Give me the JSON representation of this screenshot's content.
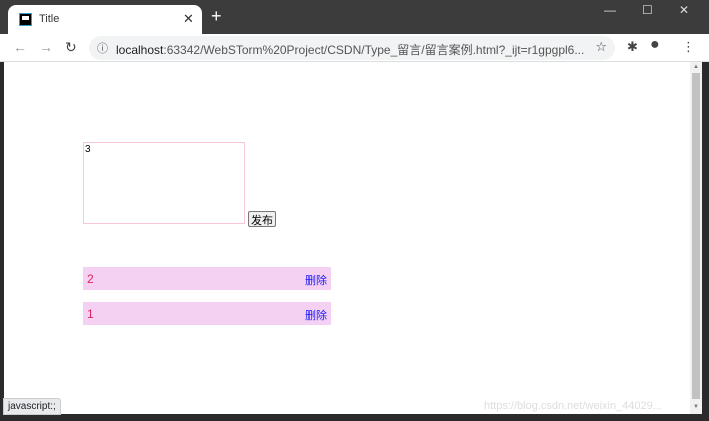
{
  "browser": {
    "tab_title": "Title",
    "url_host": "localhost",
    "url_rest": ":63342/WebSTorm%20Project/CSDN/Type_留言/留言案例.html?_ijt=r1gpgpl6...",
    "status_text": "javascript:;",
    "watermark": "https://blog.csdn.net/weixin_44029..."
  },
  "form": {
    "textarea_value": "3",
    "publish_label": "发布"
  },
  "messages": [
    {
      "text": "2",
      "delete_label": "删除"
    },
    {
      "text": "1",
      "delete_label": "删除"
    }
  ]
}
